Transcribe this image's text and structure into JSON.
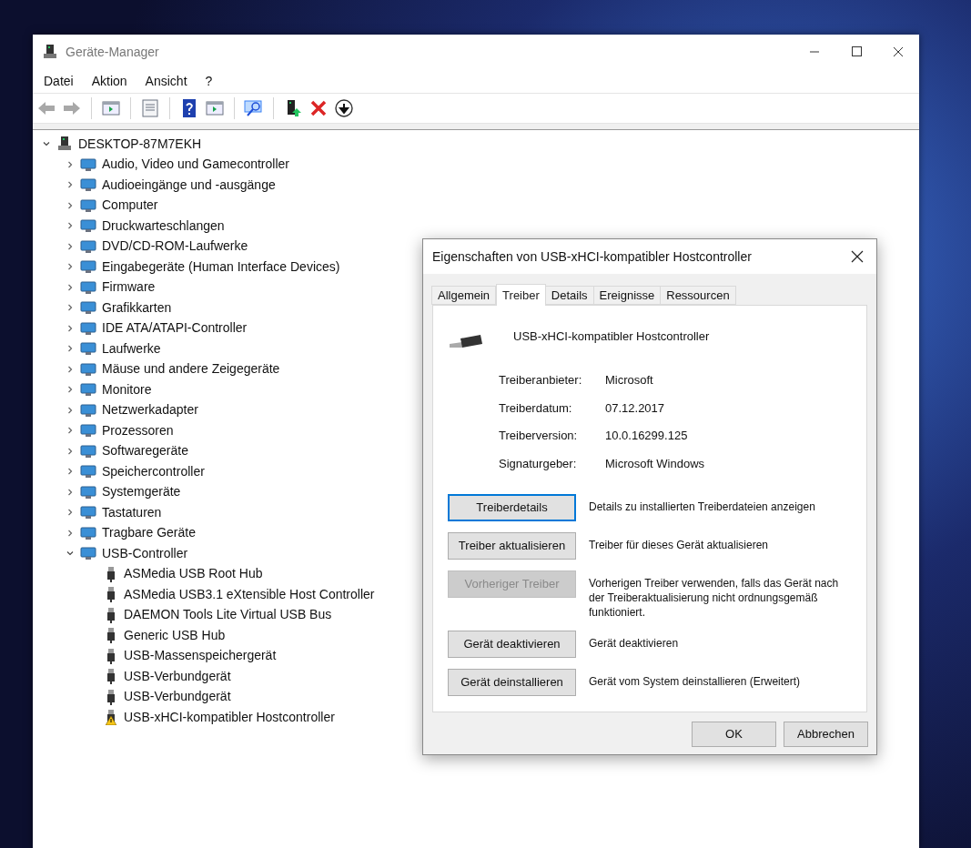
{
  "window": {
    "title": "Geräte-Manager"
  },
  "menu": [
    "Datei",
    "Aktion",
    "Ansicht",
    "?"
  ],
  "toolbar": [
    {
      "kind": "back",
      "disabled": true
    },
    {
      "kind": "forward",
      "disabled": true
    },
    {
      "kind": "view",
      "disabled": false
    },
    {
      "kind": "properties",
      "disabled": false
    },
    {
      "kind": "help",
      "disabled": false
    },
    {
      "kind": "view",
      "disabled": false
    },
    {
      "kind": "scan",
      "disabled": false
    },
    {
      "kind": "update",
      "disabled": false
    },
    {
      "kind": "remove",
      "disabled": false
    },
    {
      "kind": "download",
      "disabled": false
    }
  ],
  "tree": {
    "label": "DESKTOP-87M7EKH",
    "expanded": true,
    "children": [
      {
        "label": "Audio, Video und Gamecontroller",
        "expanded": false
      },
      {
        "label": "Audioeingänge und -ausgänge",
        "expanded": false
      },
      {
        "label": "Computer",
        "expanded": false
      },
      {
        "label": "Druckwarteschlangen",
        "expanded": false
      },
      {
        "label": "DVD/CD-ROM-Laufwerke",
        "expanded": false
      },
      {
        "label": "Eingabegeräte (Human Interface Devices)",
        "expanded": false
      },
      {
        "label": "Firmware",
        "expanded": false
      },
      {
        "label": "Grafikkarten",
        "expanded": false
      },
      {
        "label": "IDE ATA/ATAPI-Controller",
        "expanded": false
      },
      {
        "label": "Laufwerke",
        "expanded": false
      },
      {
        "label": "Mäuse und andere Zeigegeräte",
        "expanded": false
      },
      {
        "label": "Monitore",
        "expanded": false
      },
      {
        "label": "Netzwerkadapter",
        "expanded": false
      },
      {
        "label": "Prozessoren",
        "expanded": false
      },
      {
        "label": "Softwaregeräte",
        "expanded": false
      },
      {
        "label": "Speichercontroller",
        "expanded": false
      },
      {
        "label": "Systemgeräte",
        "expanded": false
      },
      {
        "label": "Tastaturen",
        "expanded": false
      },
      {
        "label": "Tragbare Geräte",
        "expanded": false
      },
      {
        "label": "USB-Controller",
        "expanded": true,
        "children": [
          {
            "label": "ASMedia USB Root Hub",
            "warning": false
          },
          {
            "label": "ASMedia USB3.1 eXtensible Host Controller",
            "warning": false
          },
          {
            "label": "DAEMON Tools Lite Virtual USB Bus",
            "warning": false
          },
          {
            "label": "Generic USB Hub",
            "warning": false
          },
          {
            "label": "USB-Massenspeichergerät",
            "warning": false
          },
          {
            "label": "USB-Verbundgerät",
            "warning": false
          },
          {
            "label": "USB-Verbundgerät",
            "warning": false
          },
          {
            "label": "USB-xHCI-kompatibler Hostcontroller",
            "warning": true
          }
        ]
      }
    ]
  },
  "dialog": {
    "title": "Eigenschaften von USB-xHCI-kompatibler Hostcontroller",
    "tabs": [
      {
        "label": "Allgemein",
        "selected": false
      },
      {
        "label": "Treiber",
        "selected": true
      },
      {
        "label": "Details",
        "selected": false
      },
      {
        "label": "Ereignisse",
        "selected": false
      },
      {
        "label": "Ressourcen",
        "selected": false
      }
    ],
    "device_name": "USB-xHCI-kompatibler Hostcontroller",
    "properties": [
      {
        "label": "Treiberanbieter:",
        "value": "Microsoft"
      },
      {
        "label": "Treiberdatum:",
        "value": "07.12.2017"
      },
      {
        "label": "Treiberversion:",
        "value": "10.0.16299.125"
      },
      {
        "label": "Signaturgeber:",
        "value": "Microsoft Windows"
      }
    ],
    "actions": [
      {
        "button": "Treiberdetails",
        "description": "Details zu installierten Treiberdateien anzeigen",
        "disabled": false,
        "focused": true
      },
      {
        "button": "Treiber aktualisieren",
        "description": "Treiber für dieses Gerät aktualisieren",
        "disabled": false,
        "focused": false
      },
      {
        "button": "Vorheriger Treiber",
        "description": "Vorherigen Treiber verwenden, falls das Gerät nach der Treiberaktualisierung nicht ordnungsgemäß funktioniert.",
        "disabled": true,
        "focused": false
      },
      {
        "button": "Gerät deaktivieren",
        "description": "Gerät deaktivieren",
        "disabled": false,
        "focused": false
      },
      {
        "button": "Gerät deinstallieren",
        "description": "Gerät vom System deinstallieren (Erweitert)",
        "disabled": false,
        "focused": false
      }
    ],
    "buttons": [
      "OK",
      "Abbrechen"
    ]
  }
}
